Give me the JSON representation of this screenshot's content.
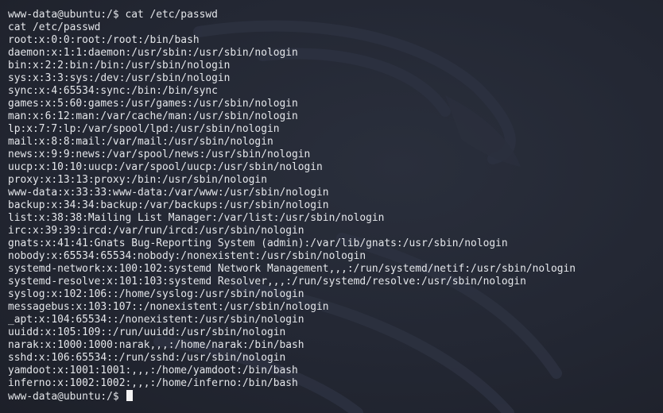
{
  "colors": {
    "background": "#232733",
    "text": "#e4e6ea",
    "cursor": "#f4f4f4"
  },
  "watermark": {
    "icon": "kali-dragon-icon"
  },
  "terminal": {
    "command_line": "www-data@ubuntu:/$ cat /etc/passwd",
    "echo_line": "cat /etc/passwd",
    "lines": [
      "root:x:0:0:root:/root:/bin/bash",
      "daemon:x:1:1:daemon:/usr/sbin:/usr/sbin/nologin",
      "bin:x:2:2:bin:/bin:/usr/sbin/nologin",
      "sys:x:3:3:sys:/dev:/usr/sbin/nologin",
      "sync:x:4:65534:sync:/bin:/bin/sync",
      "games:x:5:60:games:/usr/games:/usr/sbin/nologin",
      "man:x:6:12:man:/var/cache/man:/usr/sbin/nologin",
      "lp:x:7:7:lp:/var/spool/lpd:/usr/sbin/nologin",
      "mail:x:8:8:mail:/var/mail:/usr/sbin/nologin",
      "news:x:9:9:news:/var/spool/news:/usr/sbin/nologin",
      "uucp:x:10:10:uucp:/var/spool/uucp:/usr/sbin/nologin",
      "proxy:x:13:13:proxy:/bin:/usr/sbin/nologin",
      "www-data:x:33:33:www-data:/var/www:/usr/sbin/nologin",
      "backup:x:34:34:backup:/var/backups:/usr/sbin/nologin",
      "list:x:38:38:Mailing List Manager:/var/list:/usr/sbin/nologin",
      "irc:x:39:39:ircd:/var/run/ircd:/usr/sbin/nologin",
      "gnats:x:41:41:Gnats Bug-Reporting System (admin):/var/lib/gnats:/usr/sbin/nologin",
      "nobody:x:65534:65534:nobody:/nonexistent:/usr/sbin/nologin",
      "systemd-network:x:100:102:systemd Network Management,,,:/run/systemd/netif:/usr/sbin/nologin",
      "systemd-resolve:x:101:103:systemd Resolver,,,:/run/systemd/resolve:/usr/sbin/nologin",
      "syslog:x:102:106::/home/syslog:/usr/sbin/nologin",
      "messagebus:x:103:107::/nonexistent:/usr/sbin/nologin",
      "_apt:x:104:65534::/nonexistent:/usr/sbin/nologin",
      "uuidd:x:105:109::/run/uuidd:/usr/sbin/nologin",
      "narak:x:1000:1000:narak,,,:/home/narak:/bin/bash",
      "sshd:x:106:65534::/run/sshd:/usr/sbin/nologin",
      "yamdoot:x:1001:1001:,,,:/home/yamdoot:/bin/bash",
      "inferno:x:1002:1002:,,,:/home/inferno:/bin/bash"
    ],
    "prompt": "www-data@ubuntu:/$ "
  }
}
